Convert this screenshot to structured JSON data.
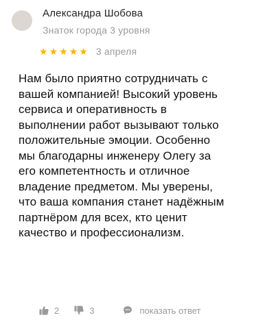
{
  "author": {
    "name": "Александра Шобова",
    "level": "Знаток города 3 уровня"
  },
  "rating": {
    "stars": 5,
    "max": 5,
    "star_color": "#f7b500"
  },
  "date": "3 апреля",
  "text": "Нам было приятно сотрудничать с\nвашей компанией! Высокий уровень\nсервиса и оперативность в\nвыполнении работ вызывают только\nположительные эмоции. Особенно\nмы благодарны инженеру Олегу за\nего компетентность и отличное\nвладение предметом. Мы уверены,\nчто ваша компания станет надёжным\nпартнёром для всех, кто ценит\nкачество и профессионализм.",
  "actions": {
    "likes": "2",
    "dislikes": "3",
    "reply_label": "показать ответ",
    "like_icon": "thumbs-up-icon",
    "dislike_icon": "thumbs-down-icon",
    "reply_icon": "speech-bubble-icon"
  }
}
